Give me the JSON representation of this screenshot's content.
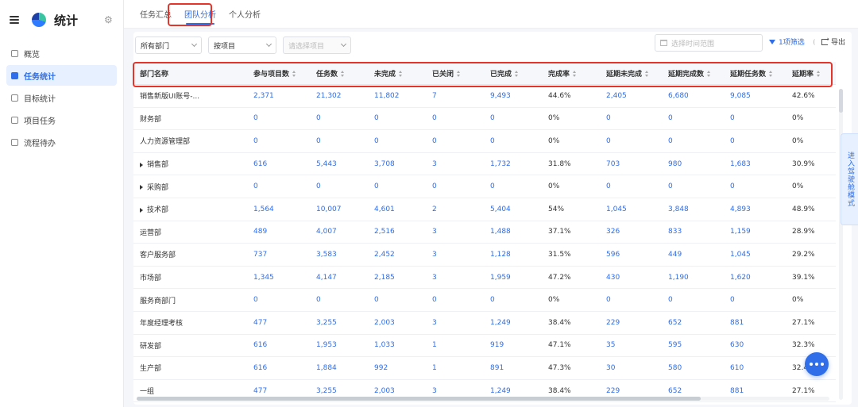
{
  "sidebar": {
    "title": "统计",
    "items": [
      {
        "label": "概览",
        "active": false
      },
      {
        "label": "任务统计",
        "active": true
      },
      {
        "label": "目标统计",
        "active": false
      },
      {
        "label": "项目任务",
        "active": false
      },
      {
        "label": "流程待办",
        "active": false
      }
    ]
  },
  "tabs": [
    {
      "label": "任务汇总",
      "active": false
    },
    {
      "label": "团队分析",
      "active": true
    },
    {
      "label": "个人分析",
      "active": false
    }
  ],
  "filters": {
    "department": "所有部门",
    "group_by": "按项目",
    "project_placeholder": "请选择项目",
    "date_placeholder": "选择时间范围",
    "filter_label": "1项筛选",
    "export_label": "导出"
  },
  "table": {
    "headers": [
      "部门名称",
      "参与项目数",
      "任务数",
      "未完成",
      "已关闭",
      "已完成",
      "完成率",
      "延期未完成",
      "延期完成数",
      "延期任务数",
      "延期率"
    ],
    "rows": [
      {
        "name": "销售新版UI账号-...",
        "expandable": false,
        "values": [
          "2,371",
          "21,302",
          "11,802",
          "7",
          "9,493",
          "44.6%",
          "2,405",
          "6,680",
          "9,085",
          "42.6%"
        ]
      },
      {
        "name": "财务部",
        "expandable": false,
        "values": [
          "0",
          "0",
          "0",
          "0",
          "0",
          "0%",
          "0",
          "0",
          "0",
          "0%"
        ]
      },
      {
        "name": "人力资源管理部",
        "expandable": false,
        "values": [
          "0",
          "0",
          "0",
          "0",
          "0",
          "0%",
          "0",
          "0",
          "0",
          "0%"
        ]
      },
      {
        "name": "销售部",
        "expandable": true,
        "values": [
          "616",
          "5,443",
          "3,708",
          "3",
          "1,732",
          "31.8%",
          "703",
          "980",
          "1,683",
          "30.9%"
        ]
      },
      {
        "name": "采购部",
        "expandable": true,
        "values": [
          "0",
          "0",
          "0",
          "0",
          "0",
          "0%",
          "0",
          "0",
          "0",
          "0%"
        ]
      },
      {
        "name": "技术部",
        "expandable": true,
        "values": [
          "1,564",
          "10,007",
          "4,601",
          "2",
          "5,404",
          "54%",
          "1,045",
          "3,848",
          "4,893",
          "48.9%"
        ]
      },
      {
        "name": "运营部",
        "expandable": false,
        "values": [
          "489",
          "4,007",
          "2,516",
          "3",
          "1,488",
          "37.1%",
          "326",
          "833",
          "1,159",
          "28.9%"
        ]
      },
      {
        "name": "客户服务部",
        "expandable": false,
        "values": [
          "737",
          "3,583",
          "2,452",
          "3",
          "1,128",
          "31.5%",
          "596",
          "449",
          "1,045",
          "29.2%"
        ]
      },
      {
        "name": "市场部",
        "expandable": false,
        "values": [
          "1,345",
          "4,147",
          "2,185",
          "3",
          "1,959",
          "47.2%",
          "430",
          "1,190",
          "1,620",
          "39.1%"
        ]
      },
      {
        "name": "服务商部门",
        "expandable": false,
        "values": [
          "0",
          "0",
          "0",
          "0",
          "0",
          "0%",
          "0",
          "0",
          "0",
          "0%"
        ]
      },
      {
        "name": "年度经理考核",
        "expandable": false,
        "values": [
          "477",
          "3,255",
          "2,003",
          "3",
          "1,249",
          "38.4%",
          "229",
          "652",
          "881",
          "27.1%"
        ]
      },
      {
        "name": "研发部",
        "expandable": false,
        "values": [
          "616",
          "1,953",
          "1,033",
          "1",
          "919",
          "47.1%",
          "35",
          "595",
          "630",
          "32.3%"
        ]
      },
      {
        "name": "生产部",
        "expandable": false,
        "values": [
          "616",
          "1,884",
          "992",
          "1",
          "891",
          "47.3%",
          "30",
          "580",
          "610",
          "32.4%"
        ]
      },
      {
        "name": "一组",
        "expandable": false,
        "values": [
          "477",
          "3,255",
          "2,003",
          "3",
          "1,249",
          "38.4%",
          "229",
          "652",
          "881",
          "27.1%"
        ]
      }
    ]
  },
  "drive_mode_label": "进入驾驶舱模式",
  "colors": {
    "accent": "#2f6ee8",
    "highlight_border": "#e5352b"
  }
}
